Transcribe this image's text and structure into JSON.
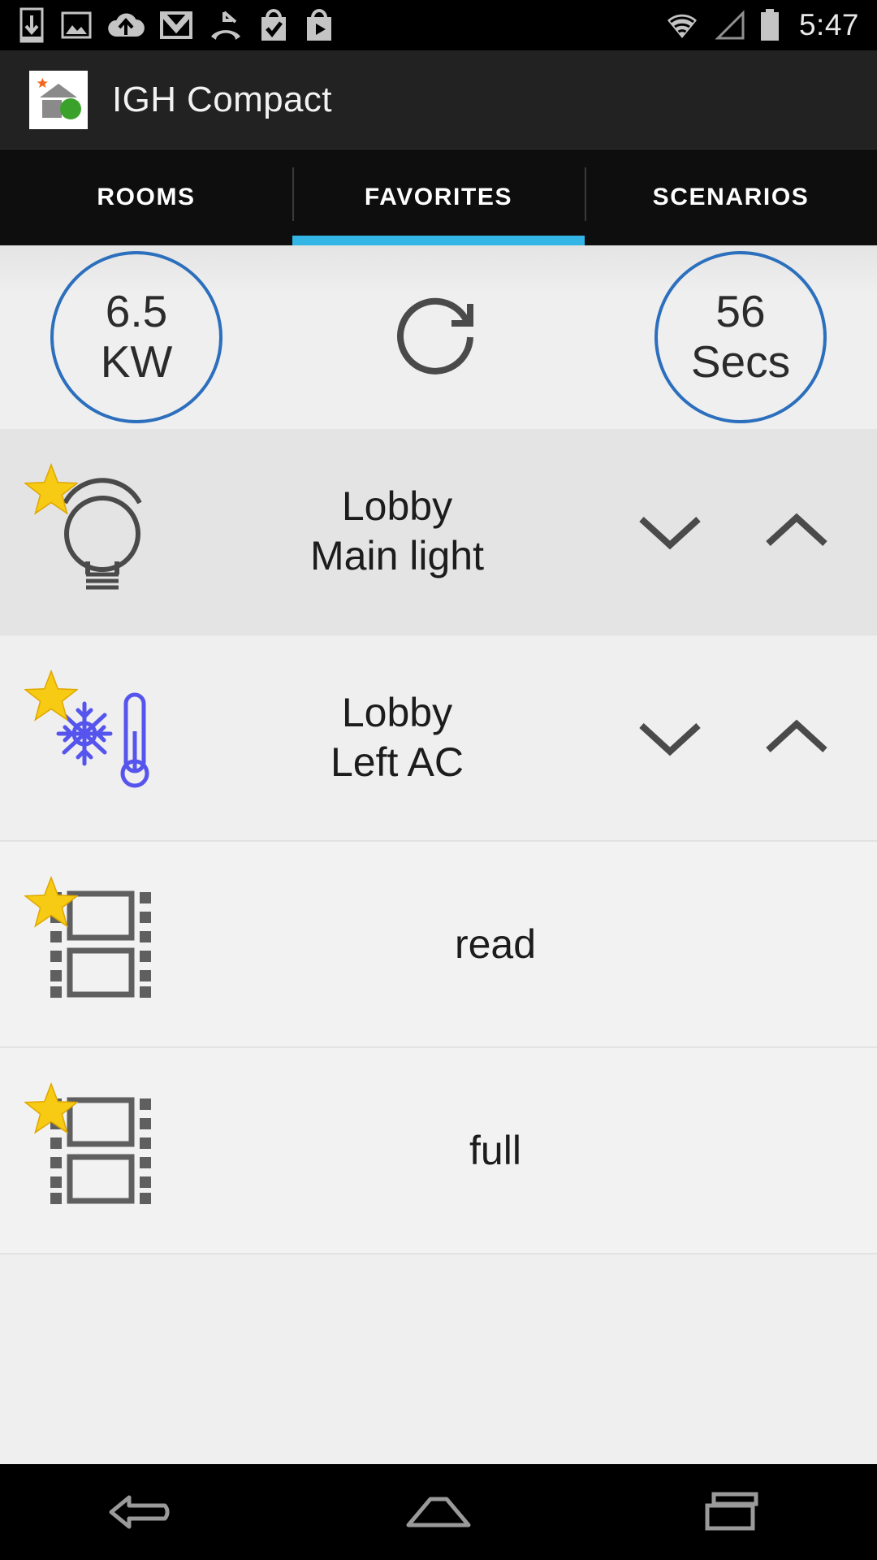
{
  "statusbar": {
    "time": "5:47",
    "icons": [
      {
        "name": "download-icon"
      },
      {
        "name": "screenshot-image-icon"
      },
      {
        "name": "cloud-upload-icon"
      },
      {
        "name": "gmail-icon"
      },
      {
        "name": "missed-call-icon"
      },
      {
        "name": "play-store-check-icon"
      },
      {
        "name": "play-store-play-icon"
      }
    ],
    "right_icons": [
      {
        "name": "wifi-icon"
      },
      {
        "name": "cellular-signal-icon"
      },
      {
        "name": "battery-icon"
      }
    ]
  },
  "actionbar": {
    "title": "IGH Compact",
    "app_icon_name": "igh-compact-app-icon"
  },
  "tabs": [
    {
      "label": "ROOMS",
      "active": false
    },
    {
      "label": "FAVORITES",
      "active": true
    },
    {
      "label": "SCENARIOS",
      "active": false
    }
  ],
  "energy": {
    "power": {
      "value": "6.5",
      "unit": "KW"
    },
    "refresh_label": "refresh-icon",
    "timer": {
      "value": "56",
      "unit": "Secs"
    }
  },
  "favorites": [
    {
      "label": "Lobby\nMain light",
      "label_line1": "Lobby",
      "label_line2": "Main light",
      "icon": "light-bulb-icon",
      "starred": true,
      "has_controls": true,
      "down_label": "chevron-down-icon",
      "up_label": "chevron-up-icon"
    },
    {
      "label": "Lobby\nLeft AC",
      "label_line1": "Lobby",
      "label_line2": "Left AC",
      "icon": "air-conditioner-icon",
      "starred": true,
      "has_controls": true,
      "down_label": "chevron-down-icon",
      "up_label": "chevron-up-icon"
    },
    {
      "label": "read",
      "label_line1": "read",
      "label_line2": "",
      "icon": "scenario-film-icon",
      "starred": true,
      "has_controls": false
    },
    {
      "label": "full",
      "label_line1": "full",
      "label_line2": "",
      "icon": "scenario-film-icon",
      "starred": true,
      "has_controls": false
    }
  ],
  "navbar": [
    {
      "name": "back-button"
    },
    {
      "name": "home-button"
    },
    {
      "name": "recents-button"
    }
  ],
  "colors": {
    "accent_blue": "#33b5e5",
    "gauge_blue": "#2c6fbd",
    "star_yellow": "#f7cb13",
    "ac_icon_blue": "#5555ee",
    "actionbar_bg": "#222222",
    "tabbar_bg": "#0e0e0e"
  }
}
